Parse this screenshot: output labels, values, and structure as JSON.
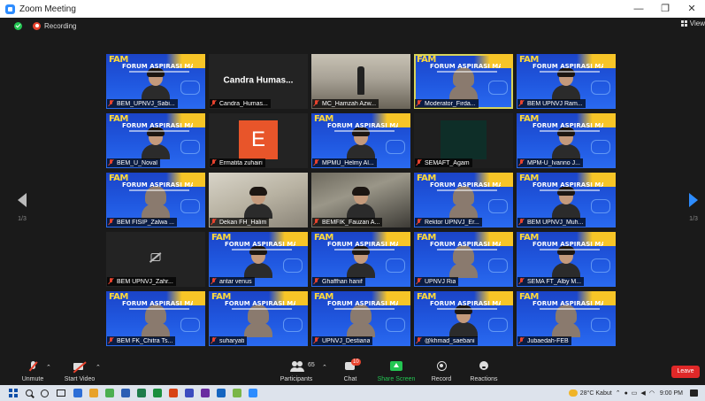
{
  "window": {
    "title": "Zoom Meeting",
    "controls": [
      "—",
      "❐",
      "✕"
    ]
  },
  "top": {
    "recording_label": "Recording",
    "view_label": "View"
  },
  "nav": {
    "left_page": "1/3",
    "right_page": "1/3"
  },
  "fam": {
    "logo": "FAM",
    "title": "FORUM ASPIRASI MAHASISWA"
  },
  "tiles": [
    {
      "name": "BEM_UPNVJ_Sabi...",
      "kind": "fam"
    },
    {
      "name": "Candra_Humas...",
      "kind": "blank",
      "center": "Candra Humas..."
    },
    {
      "name": "MC_Hamzah Azw...",
      "kind": "photo-stage"
    },
    {
      "name": "Moderator_Firda...",
      "kind": "fam",
      "active": true,
      "hijab": true
    },
    {
      "name": "BEM UPNVJ Ram...",
      "kind": "fam"
    },
    {
      "name": "BEM_U_Noval",
      "kind": "fam"
    },
    {
      "name": "Ermatita zuhairi",
      "kind": "avatar",
      "letter": "E"
    },
    {
      "name": "MPMU_Helmy Al...",
      "kind": "fam"
    },
    {
      "name": "SEMAFT_Agam",
      "kind": "dark-cam"
    },
    {
      "name": "MPM-U_Ivanno J...",
      "kind": "fam"
    },
    {
      "name": "BEM FISIP_Zalwa ...",
      "kind": "fam",
      "hijab": true
    },
    {
      "name": "Dekan FH_Halim",
      "kind": "photo-light"
    },
    {
      "name": "BEMFIK_Fauzan A...",
      "kind": "photo"
    },
    {
      "name": "Rektor UPNVJ_Er...",
      "kind": "fam",
      "hijab": true
    },
    {
      "name": "BEM UPNVJ_Muh...",
      "kind": "fam"
    },
    {
      "name": "BEM UPNVJ_Zahr...",
      "kind": "video-off"
    },
    {
      "name": "antar venus",
      "kind": "fam"
    },
    {
      "name": "Ghaffhan hanif",
      "kind": "fam"
    },
    {
      "name": "UPNVJ Ria",
      "kind": "fam",
      "hijab": true
    },
    {
      "name": "SEMA FT_Alby M...",
      "kind": "fam"
    },
    {
      "name": "BEM FK_Chitra Ts...",
      "kind": "fam",
      "hijab": true
    },
    {
      "name": "suharyati",
      "kind": "fam",
      "hijab": true
    },
    {
      "name": "UPNVJ_Destiana",
      "kind": "fam",
      "hijab": true
    },
    {
      "name": "@khmad_saebani",
      "kind": "fam"
    },
    {
      "name": "Jubaedah-FEB",
      "kind": "fam",
      "hijab": true
    }
  ],
  "toolbar": {
    "unmute": "Unmute",
    "start_video": "Start Video",
    "participants": "Participants",
    "participants_count": "65",
    "chat": "Chat",
    "chat_badge": "10",
    "share_screen": "Share Screen",
    "record": "Record",
    "reactions": "Reactions",
    "leave": "Leave"
  },
  "taskbar": {
    "weather": "28°C  Kabut",
    "time": "9:00 PM",
    "app_colors": [
      "#2d6ed6",
      "#e8a22a",
      "#4caf50",
      "#2b5fb4",
      "#1e7c4a",
      "#1b8f3e",
      "#d84315",
      "#3c4cbf",
      "#6a2ca0",
      "#1565c0",
      "#7ab648",
      "#2d8cff"
    ]
  }
}
